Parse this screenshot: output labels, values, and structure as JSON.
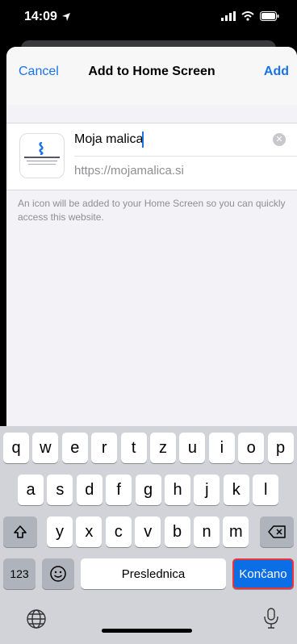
{
  "status": {
    "time": "14:09"
  },
  "sheet": {
    "cancel": "Cancel",
    "title": "Add to Home Screen",
    "add": "Add",
    "name_value": "Moja malica",
    "url": "https://mojamalica.si",
    "hint": "An icon will be added to your Home Screen so you can quickly access this website."
  },
  "keyboard": {
    "row1": [
      "q",
      "w",
      "e",
      "r",
      "t",
      "z",
      "u",
      "i",
      "o",
      "p"
    ],
    "row2": [
      "a",
      "s",
      "d",
      "f",
      "g",
      "h",
      "j",
      "k",
      "l"
    ],
    "row3": [
      "y",
      "x",
      "c",
      "v",
      "b",
      "n",
      "m"
    ],
    "numbers_label": "123",
    "space_label": "Preslednica",
    "done_label": "Končano"
  },
  "icons": [
    "location-arrow-icon",
    "signal-icon",
    "wifi-icon",
    "battery-icon",
    "clear-icon",
    "shift-icon",
    "backspace-icon",
    "emoji-icon",
    "globe-icon",
    "microphone-icon"
  ]
}
